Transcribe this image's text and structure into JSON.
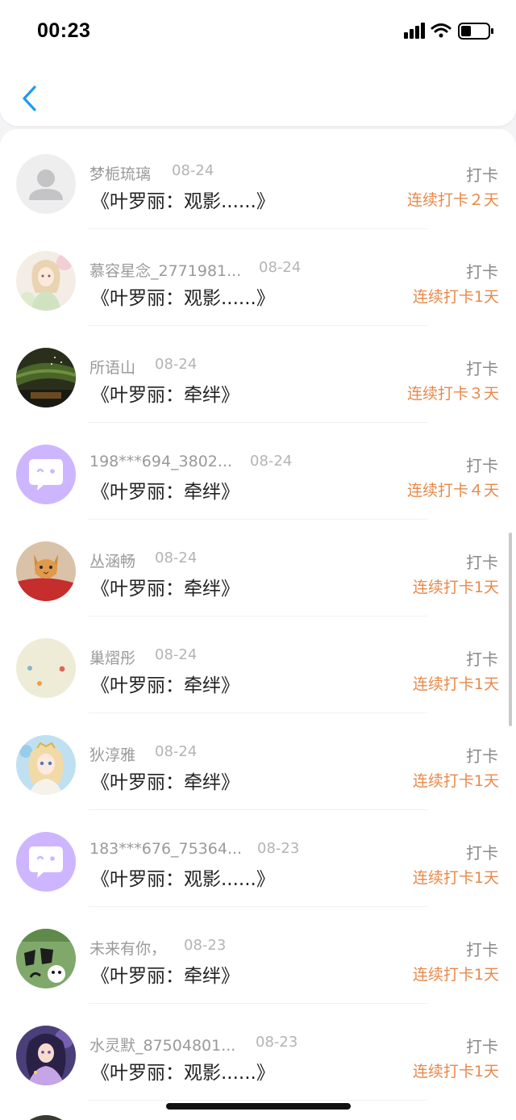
{
  "status_bar": {
    "time": "00:23"
  },
  "colors": {
    "accent_blue": "#1d9bf0",
    "streak_orange": "#e8894a",
    "bubble_purple": "#cdb6ff"
  },
  "list": [
    {
      "name": "梦栀琉璃",
      "date": "08-24",
      "book": "《叶罗丽：观影......》",
      "checkin": "打卡",
      "streak": "连续打卡２天",
      "avatar": "default-avatar"
    },
    {
      "name": "慕容星念_2771981...",
      "date": "08-24",
      "book": "《叶罗丽：观影......》",
      "checkin": "打卡",
      "streak": "连续打卡1天",
      "avatar": "anime-girl-pastel"
    },
    {
      "name": "所语山",
      "date": "08-24",
      "book": "《叶罗丽：牵绊》",
      "checkin": "打卡",
      "streak": "连续打卡３天",
      "avatar": "aurora-night"
    },
    {
      "name": "198***694_3802...",
      "date": "08-24",
      "book": "《叶罗丽：牵绊》",
      "checkin": "打卡",
      "streak": "连续打卡４天",
      "avatar": "chat-bubble"
    },
    {
      "name": "丛涵畅",
      "date": "08-24",
      "book": "《叶罗丽：牵绊》",
      "checkin": "打卡",
      "streak": "连续打卡1天",
      "avatar": "cat-red"
    },
    {
      "name": "巢熠彤",
      "date": "08-24",
      "book": "《叶罗丽：牵绊》",
      "checkin": "打卡",
      "streak": "连续打卡1天",
      "avatar": "dots-cream"
    },
    {
      "name": "狄淳雅",
      "date": "08-24",
      "book": "《叶罗丽：牵绊》",
      "checkin": "打卡",
      "streak": "连续打卡1天",
      "avatar": "anime-girl-blue"
    },
    {
      "name": "183***676_75364...",
      "date": "08-23",
      "book": "《叶罗丽：观影......》",
      "checkin": "打卡",
      "streak": "连续打卡1天",
      "avatar": "chat-bubble"
    },
    {
      "name": "未来有你，",
      "date": "08-23",
      "book": "《叶罗丽：牵绊》",
      "checkin": "打卡",
      "streak": "连续打卡1天",
      "avatar": "green-sticker"
    },
    {
      "name": "水灵默_87504801...",
      "date": "08-23",
      "book": "《叶罗丽：观影......》",
      "checkin": "打卡",
      "streak": "连续打卡1天",
      "avatar": "anime-girl-purple"
    }
  ]
}
